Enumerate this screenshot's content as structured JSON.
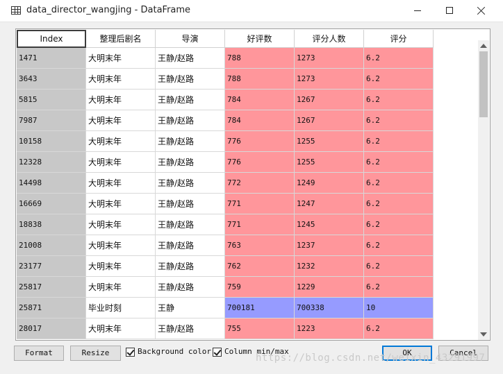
{
  "window": {
    "title": "data_director_wangjing - DataFrame"
  },
  "table": {
    "columns": [
      "Index",
      "整理后剧名",
      "导演",
      "好评数",
      "评分人数",
      "评分"
    ],
    "rows": [
      {
        "index": "1471",
        "name": "大明末年",
        "director": "王静/赵路",
        "good": "788",
        "count": "1273",
        "score": "6.2",
        "color": "red"
      },
      {
        "index": "3643",
        "name": "大明末年",
        "director": "王静/赵路",
        "good": "788",
        "count": "1273",
        "score": "6.2",
        "color": "red"
      },
      {
        "index": "5815",
        "name": "大明末年",
        "director": "王静/赵路",
        "good": "784",
        "count": "1267",
        "score": "6.2",
        "color": "red"
      },
      {
        "index": "7987",
        "name": "大明末年",
        "director": "王静/赵路",
        "good": "784",
        "count": "1267",
        "score": "6.2",
        "color": "red"
      },
      {
        "index": "10158",
        "name": "大明末年",
        "director": "王静/赵路",
        "good": "776",
        "count": "1255",
        "score": "6.2",
        "color": "red"
      },
      {
        "index": "12328",
        "name": "大明末年",
        "director": "王静/赵路",
        "good": "776",
        "count": "1255",
        "score": "6.2",
        "color": "red"
      },
      {
        "index": "14498",
        "name": "大明末年",
        "director": "王静/赵路",
        "good": "772",
        "count": "1249",
        "score": "6.2",
        "color": "red"
      },
      {
        "index": "16669",
        "name": "大明末年",
        "director": "王静/赵路",
        "good": "771",
        "count": "1247",
        "score": "6.2",
        "color": "red"
      },
      {
        "index": "18838",
        "name": "大明末年",
        "director": "王静/赵路",
        "good": "771",
        "count": "1245",
        "score": "6.2",
        "color": "red"
      },
      {
        "index": "21008",
        "name": "大明末年",
        "director": "王静/赵路",
        "good": "763",
        "count": "1237",
        "score": "6.2",
        "color": "red"
      },
      {
        "index": "23177",
        "name": "大明末年",
        "director": "王静/赵路",
        "good": "762",
        "count": "1232",
        "score": "6.2",
        "color": "red"
      },
      {
        "index": "25817",
        "name": "大明末年",
        "director": "王静/赵路",
        "good": "759",
        "count": "1229",
        "score": "6.2",
        "color": "red"
      },
      {
        "index": "25871",
        "name": "毕业时刻",
        "director": "王静",
        "good": "700181",
        "count": "700338",
        "score": "10",
        "color": "blue"
      },
      {
        "index": "28017",
        "name": "大明末年",
        "director": "王静/赵路",
        "good": "755",
        "count": "1223",
        "score": "6.2",
        "color": "red"
      }
    ]
  },
  "colors": {
    "red_cell": "#ff969b",
    "blue_cell": "#969bff",
    "index_cell": "#c8c8c8"
  },
  "buttons": {
    "format": "Format",
    "resize": "Resize",
    "ok": "OK",
    "cancel": "Cancel"
  },
  "checkboxes": {
    "background_color": {
      "label": "Background color",
      "checked": true
    },
    "column_minmax": {
      "label": "Column min/max",
      "checked": true
    }
  },
  "watermark": "https://blog.csdn.net/weixin_43291997"
}
